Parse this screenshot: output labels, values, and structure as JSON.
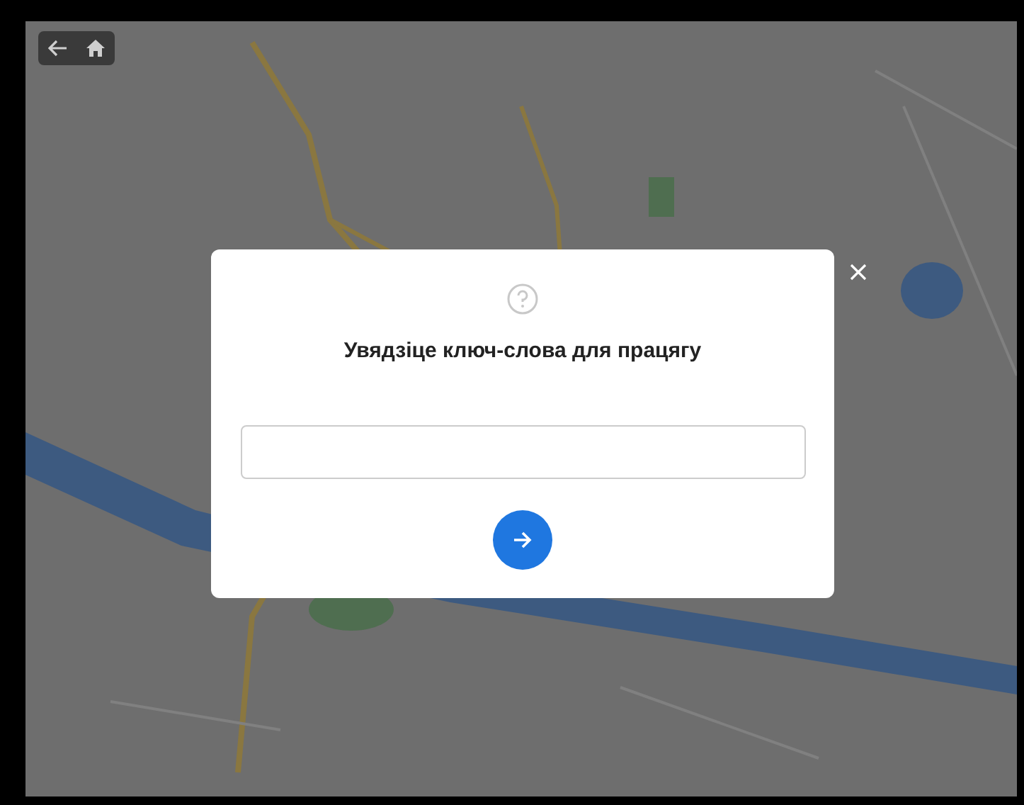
{
  "dialog": {
    "title": "Увядзіце ключ-слова для працягу"
  }
}
